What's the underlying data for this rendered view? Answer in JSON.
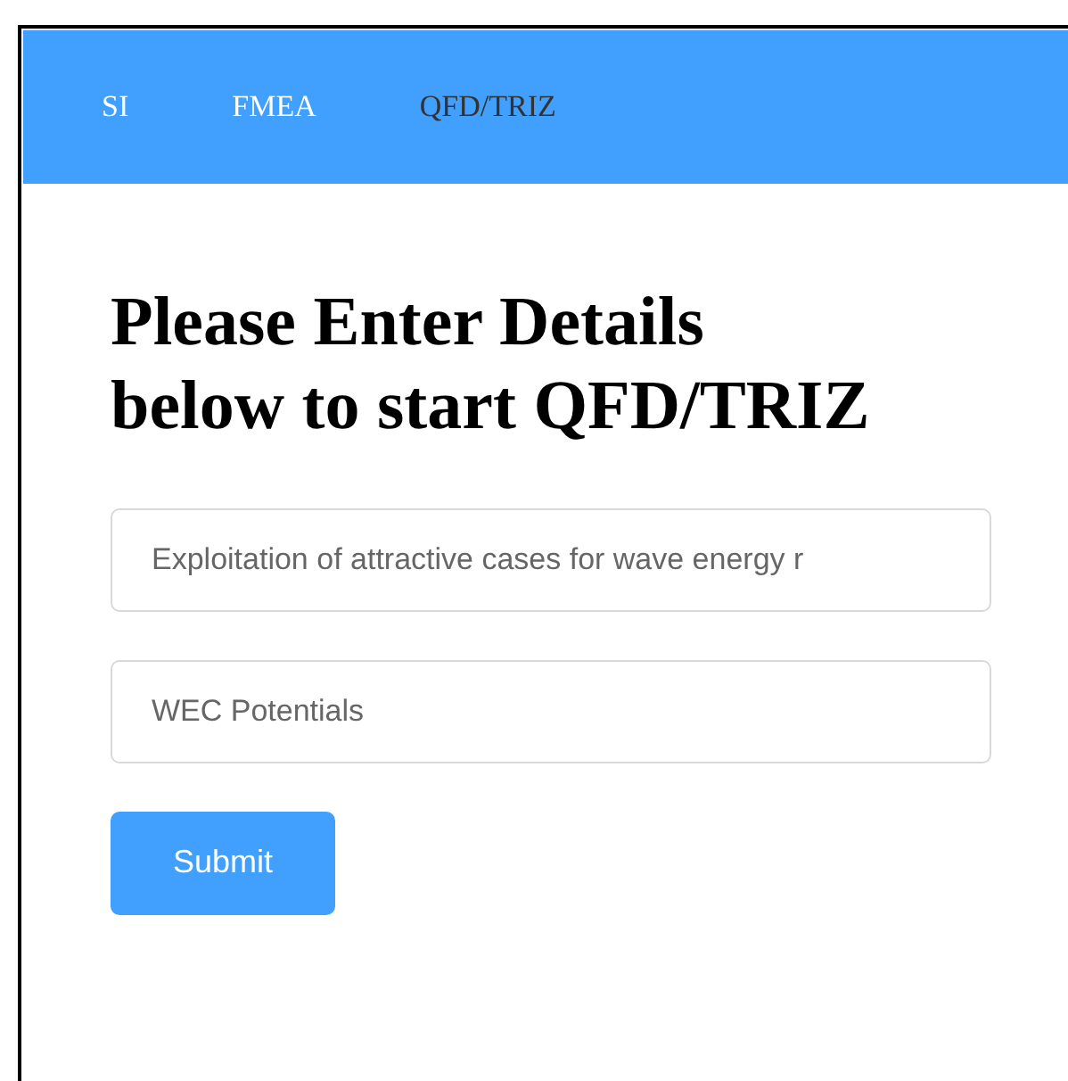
{
  "nav": [
    {
      "label": "SI",
      "selected": false
    },
    {
      "label": "FMEA",
      "selected": false
    },
    {
      "label": "QFD/TRIZ",
      "selected": true
    }
  ],
  "heading": "Please Enter Details below to start QFD/TRIZ",
  "fields": [
    {
      "value": "Exploitation of attractive cases for wave energy r"
    },
    {
      "value": "WEC Potentials"
    }
  ],
  "submit": "Submit"
}
